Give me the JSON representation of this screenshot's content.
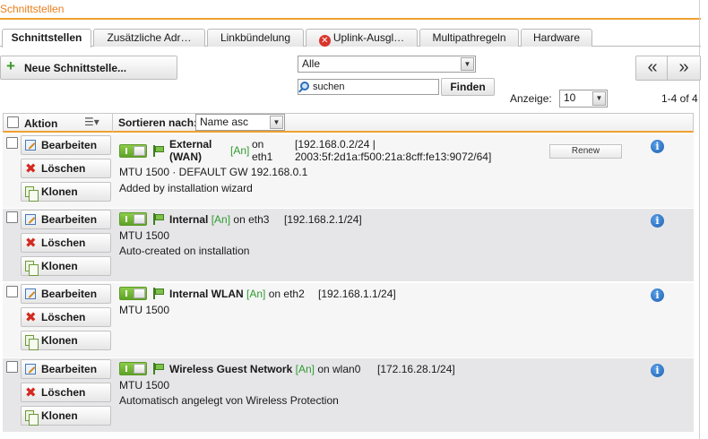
{
  "header": {
    "title": "Schnittstellen"
  },
  "tabs": [
    {
      "label": "Schnittstellen",
      "active": true
    },
    {
      "label": "Zusätzliche Adr…",
      "active": false
    },
    {
      "label": "Linkbündelung",
      "active": false
    },
    {
      "label": "Uplink-Ausgl…",
      "active": false,
      "icon": "error-icon"
    },
    {
      "label": "Multipathregeln",
      "active": false
    },
    {
      "label": "Hardware",
      "active": false
    }
  ],
  "toolbar": {
    "new_label": "Neue Schnittstelle...",
    "filter_value": "Alle",
    "search_placeholder": "suchen",
    "find_label": "Finden",
    "prev_page": "«",
    "next_page": "»",
    "display_label": "Anzeige:",
    "display_value": "10",
    "count_label": "1-4 of 4"
  },
  "list_header": {
    "action_label": "Aktion",
    "sort_label": "Sortieren nach:",
    "sort_value": "Name asc"
  },
  "actions": {
    "edit": "Bearbeiten",
    "delete": "Löschen",
    "clone": "Klonen"
  },
  "interfaces": [
    {
      "name_line1": "External",
      "name_line2": "(WAN)",
      "status": "[An]",
      "on_line1": "on",
      "on_line2": "eth1",
      "addr_line1": "[192.168.0.2/24 |",
      "addr_line2": "2003:5f:2d1a:f500:21a:8cff:fe13:9072/64]",
      "mtu": "MTU 1500 · DEFAULT GW 192.168.0.1",
      "comment": "Added by installation wizard",
      "renew_label": "Renew"
    },
    {
      "name": "Internal",
      "status": "[An]",
      "on": "on eth3",
      "addr": "[192.168.2.1/24]",
      "mtu": "MTU 1500",
      "comment": "Auto-created on installation"
    },
    {
      "name": "Internal WLAN",
      "status": "[An]",
      "on": "on eth2",
      "addr": "[192.168.1.1/24]",
      "mtu": "MTU 1500",
      "comment": ""
    },
    {
      "name": "Wireless Guest Network",
      "status": "[An]",
      "on": "on wlan0",
      "addr": "[172.16.28.1/24]",
      "mtu": "MTU 1500",
      "comment": "Automatisch angelegt von Wireless Protection"
    }
  ],
  "colors": {
    "accent": "#f0a030",
    "title": "#e87f1c",
    "status_on": "#2f9a2f",
    "info": "#1c5fb2",
    "delete": "#d32a20"
  }
}
